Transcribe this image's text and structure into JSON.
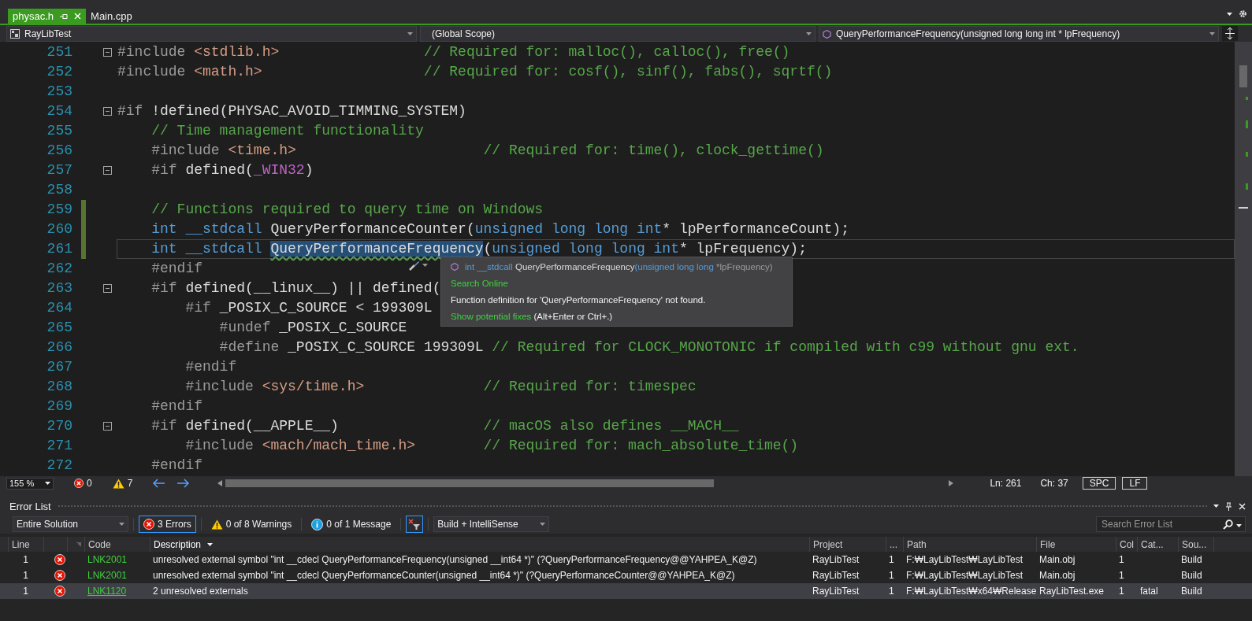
{
  "editor_tabs": [
    {
      "label": "physac.h",
      "selected": true
    },
    {
      "label": "Main.cpp",
      "selected": false
    }
  ],
  "nav_bar": {
    "project": "RayLibTest",
    "scope": "(Global Scope)",
    "member": "QueryPerformanceFrequency(unsigned long long int * lpFrequency)"
  },
  "code_lines": [
    {
      "n": "251",
      "fold": true,
      "changed": false,
      "current": false,
      "tokens": [
        {
          "kind": "pp",
          "text": "#include "
        },
        {
          "kind": "str",
          "text": "<stdlib.h>"
        },
        {
          "kind": "com",
          "text": "                 // Required for: malloc(), calloc(), free()"
        }
      ]
    },
    {
      "n": "252",
      "fold": false,
      "changed": false,
      "current": false,
      "tokens": [
        {
          "kind": "pp",
          "text": "#include "
        },
        {
          "kind": "str",
          "text": "<math.h>"
        },
        {
          "kind": "com",
          "text": "                   // Required for: cosf(), sinf(), fabs(), sqrtf()"
        }
      ]
    },
    {
      "n": "253",
      "fold": false,
      "changed": false,
      "current": false
    },
    {
      "n": "254",
      "fold": true,
      "changed": false,
      "current": false,
      "tokens": [
        {
          "kind": "pp",
          "text": "#if "
        },
        {
          "kind": "t",
          "text": "!defined(PHYSAC_AVOID_TIMMING_SYSTEM)"
        }
      ]
    },
    {
      "n": "255",
      "fold": false,
      "changed": false,
      "current": false,
      "tokens": [
        {
          "kind": "com",
          "text": "    // Time management functionality"
        }
      ]
    },
    {
      "n": "256",
      "fold": false,
      "changed": false,
      "current": false,
      "tokens": [
        {
          "kind": "pp",
          "text": "    #include "
        },
        {
          "kind": "str",
          "text": "<time.h>"
        },
        {
          "kind": "com",
          "text": "                      // Required for: time(), clock_gettime()"
        }
      ]
    },
    {
      "n": "257",
      "fold": true,
      "changed": false,
      "current": false,
      "tokens": [
        {
          "kind": "pp",
          "text": "    #if "
        },
        {
          "kind": "t",
          "text": "defined("
        },
        {
          "kind": "mac",
          "text": "_WIN32"
        },
        {
          "kind": "t",
          "text": ")"
        }
      ]
    },
    {
      "n": "258",
      "fold": false,
      "changed": false,
      "current": false
    },
    {
      "n": "259",
      "fold": false,
      "changed": true,
      "current": false,
      "tokens": [
        {
          "kind": "com",
          "text": "    // Functions required to query time on Windows"
        }
      ]
    },
    {
      "n": "260",
      "fold": false,
      "changed": true,
      "current": false,
      "tokens": [
        {
          "kind": "kw",
          "text": "    int __stdcall "
        },
        {
          "kind": "t",
          "text": "QueryPerformanceCounter("
        },
        {
          "kind": "kw",
          "text": "unsigned long long int"
        },
        {
          "kind": "t",
          "text": "* lpPerformanceCount);"
        }
      ]
    },
    {
      "n": "261",
      "fold": false,
      "changed": true,
      "current": true,
      "tokens": [
        {
          "kind": "kw",
          "text": "    int __stdcall "
        },
        {
          "kind": "sel",
          "text": "QueryPerformanceFrequency"
        },
        {
          "kind": "t",
          "text": "("
        },
        {
          "kind": "kw",
          "text": "unsigned long long int"
        },
        {
          "kind": "t",
          "text": "* lpFrequency);"
        }
      ]
    },
    {
      "n": "262",
      "fold": false,
      "changed": false,
      "current": false,
      "tokens": [
        {
          "kind": "pp",
          "text": "    #endif"
        }
      ]
    },
    {
      "n": "263",
      "fold": true,
      "changed": false,
      "current": false,
      "tokens": [
        {
          "kind": "pp",
          "text": "    #if "
        },
        {
          "kind": "t",
          "text": "defined(__linux__) || defined("
        }
      ]
    },
    {
      "n": "264",
      "fold": false,
      "changed": false,
      "current": false,
      "tokens": [
        {
          "kind": "pp",
          "text": "        #if "
        },
        {
          "kind": "t",
          "text": "_POSIX_C_SOURCE < 199309L"
        }
      ]
    },
    {
      "n": "265",
      "fold": false,
      "changed": false,
      "current": false,
      "tokens": [
        {
          "kind": "pp",
          "text": "            #undef "
        },
        {
          "kind": "t",
          "text": "_POSIX_C_SOURCE"
        }
      ]
    },
    {
      "n": "266",
      "fold": false,
      "changed": false,
      "current": false,
      "tokens": [
        {
          "kind": "pp",
          "text": "            #define "
        },
        {
          "kind": "t",
          "text": "_POSIX_C_SOURCE 199309L "
        },
        {
          "kind": "com",
          "text": "// Required for CLOCK_MONOTONIC if compiled with c99 without gnu ext."
        }
      ]
    },
    {
      "n": "267",
      "fold": false,
      "changed": false,
      "current": false,
      "tokens": [
        {
          "kind": "pp",
          "text": "        #endif"
        }
      ]
    },
    {
      "n": "268",
      "fold": false,
      "changed": false,
      "current": false,
      "tokens": [
        {
          "kind": "pp",
          "text": "        #include "
        },
        {
          "kind": "str",
          "text": "<sys/time.h>"
        },
        {
          "kind": "com",
          "text": "              // Required for: timespec"
        }
      ]
    },
    {
      "n": "269",
      "fold": false,
      "changed": false,
      "current": false,
      "tokens": [
        {
          "kind": "pp",
          "text": "    #endif"
        }
      ]
    },
    {
      "n": "270",
      "fold": true,
      "changed": false,
      "current": false,
      "tokens": [
        {
          "kind": "pp",
          "text": "    #if "
        },
        {
          "kind": "t",
          "text": "defined(__APPLE__)"
        },
        {
          "kind": "com",
          "text": "                 // macOS also defines __MACH__"
        }
      ]
    },
    {
      "n": "271",
      "fold": false,
      "changed": false,
      "current": false,
      "tokens": [
        {
          "kind": "pp",
          "text": "        #include "
        },
        {
          "kind": "str",
          "text": "<mach/mach_time.h>"
        },
        {
          "kind": "com",
          "text": "        // Required for: mach_absolute_time()"
        }
      ]
    },
    {
      "n": "272",
      "fold": false,
      "changed": false,
      "current": false,
      "tokens": [
        {
          "kind": "pp",
          "text": "    #endif"
        }
      ]
    }
  ],
  "quick_info": {
    "signature": [
      {
        "kind": "kw",
        "text": "int __stdcall "
      },
      {
        "kind": "t",
        "text": "QueryPerformanceFrequency"
      },
      {
        "kind": "kw",
        "text": "(unsigned long long "
      },
      {
        "kind": "par",
        "text": "*lpFrequency)"
      }
    ],
    "search_link": "Search Online",
    "message": "Function definition for 'QueryPerformanceFrequency' not found.",
    "fix_link": "Show potential fixes",
    "fix_shortcut": "(Alt+Enter or Ctrl+.)"
  },
  "editor_status": {
    "zoom": "155 %",
    "errors": "0",
    "warnings": "7",
    "line": "Ln: 261",
    "column": "Ch: 37",
    "whitespace": "SPC",
    "line_ending": "LF"
  },
  "error_list": {
    "title": "Error List",
    "scope": "Entire Solution",
    "filters": [
      {
        "kind": "error",
        "label": "3 Errors",
        "selected": true
      },
      {
        "kind": "warning",
        "label": "0 of 8 Warnings",
        "selected": false
      },
      {
        "kind": "info",
        "label": "0 of 1 Message",
        "selected": false
      }
    ],
    "source": "Build + IntelliSense",
    "search": {
      "placeholder": "Search Error List"
    },
    "columns": [
      {
        "label": "Line",
        "sorted": false
      },
      {
        "label": "Code",
        "sorted": false
      },
      {
        "label": "Description",
        "sorted": true
      },
      {
        "label": "Project",
        "sorted": false
      },
      {
        "label": "...",
        "sorted": false
      },
      {
        "label": "Path",
        "sorted": false
      },
      {
        "label": "File",
        "sorted": false
      },
      {
        "label": "Col",
        "sorted": false
      },
      {
        "label": "Cat...",
        "sorted": false
      },
      {
        "label": "Sou...",
        "sorted": false
      }
    ],
    "rows": [
      {
        "line": "1",
        "kind": "error",
        "code": "LNK2001",
        "code_link": false,
        "description": "unresolved external symbol \"int __cdecl QueryPerformanceFrequency(unsigned __int64 *)\" (?QueryPerformanceFrequency@@YAHPEA_K@Z)",
        "project": "RayLibTest",
        "count": "1",
        "path": "F:₩LayLibTest₩LayLibTest",
        "file": "Main.obj",
        "col": "1",
        "source": "Build",
        "selected": false
      },
      {
        "line": "1",
        "kind": "error",
        "code": "LNK2001",
        "code_link": false,
        "description": "unresolved external symbol \"int __cdecl QueryPerformanceCounter(unsigned __int64 *)\" (?QueryPerformanceCounter@@YAHPEA_K@Z)",
        "project": "RayLibTest",
        "count": "1",
        "path": "F:₩LayLibTest₩LayLibTest",
        "file": "Main.obj",
        "col": "1",
        "source": "Build",
        "selected": false
      },
      {
        "line": "1",
        "kind": "error",
        "code": "LNK1120",
        "code_link": true,
        "description": "2 unresolved externals",
        "project": "RayLibTest",
        "count": "1",
        "path": "F:₩LayLibTest₩x64₩Release",
        "file": "RayLibTest.exe",
        "col": "1",
        "category": "fatal",
        "source": "Build",
        "selected": true
      }
    ]
  }
}
